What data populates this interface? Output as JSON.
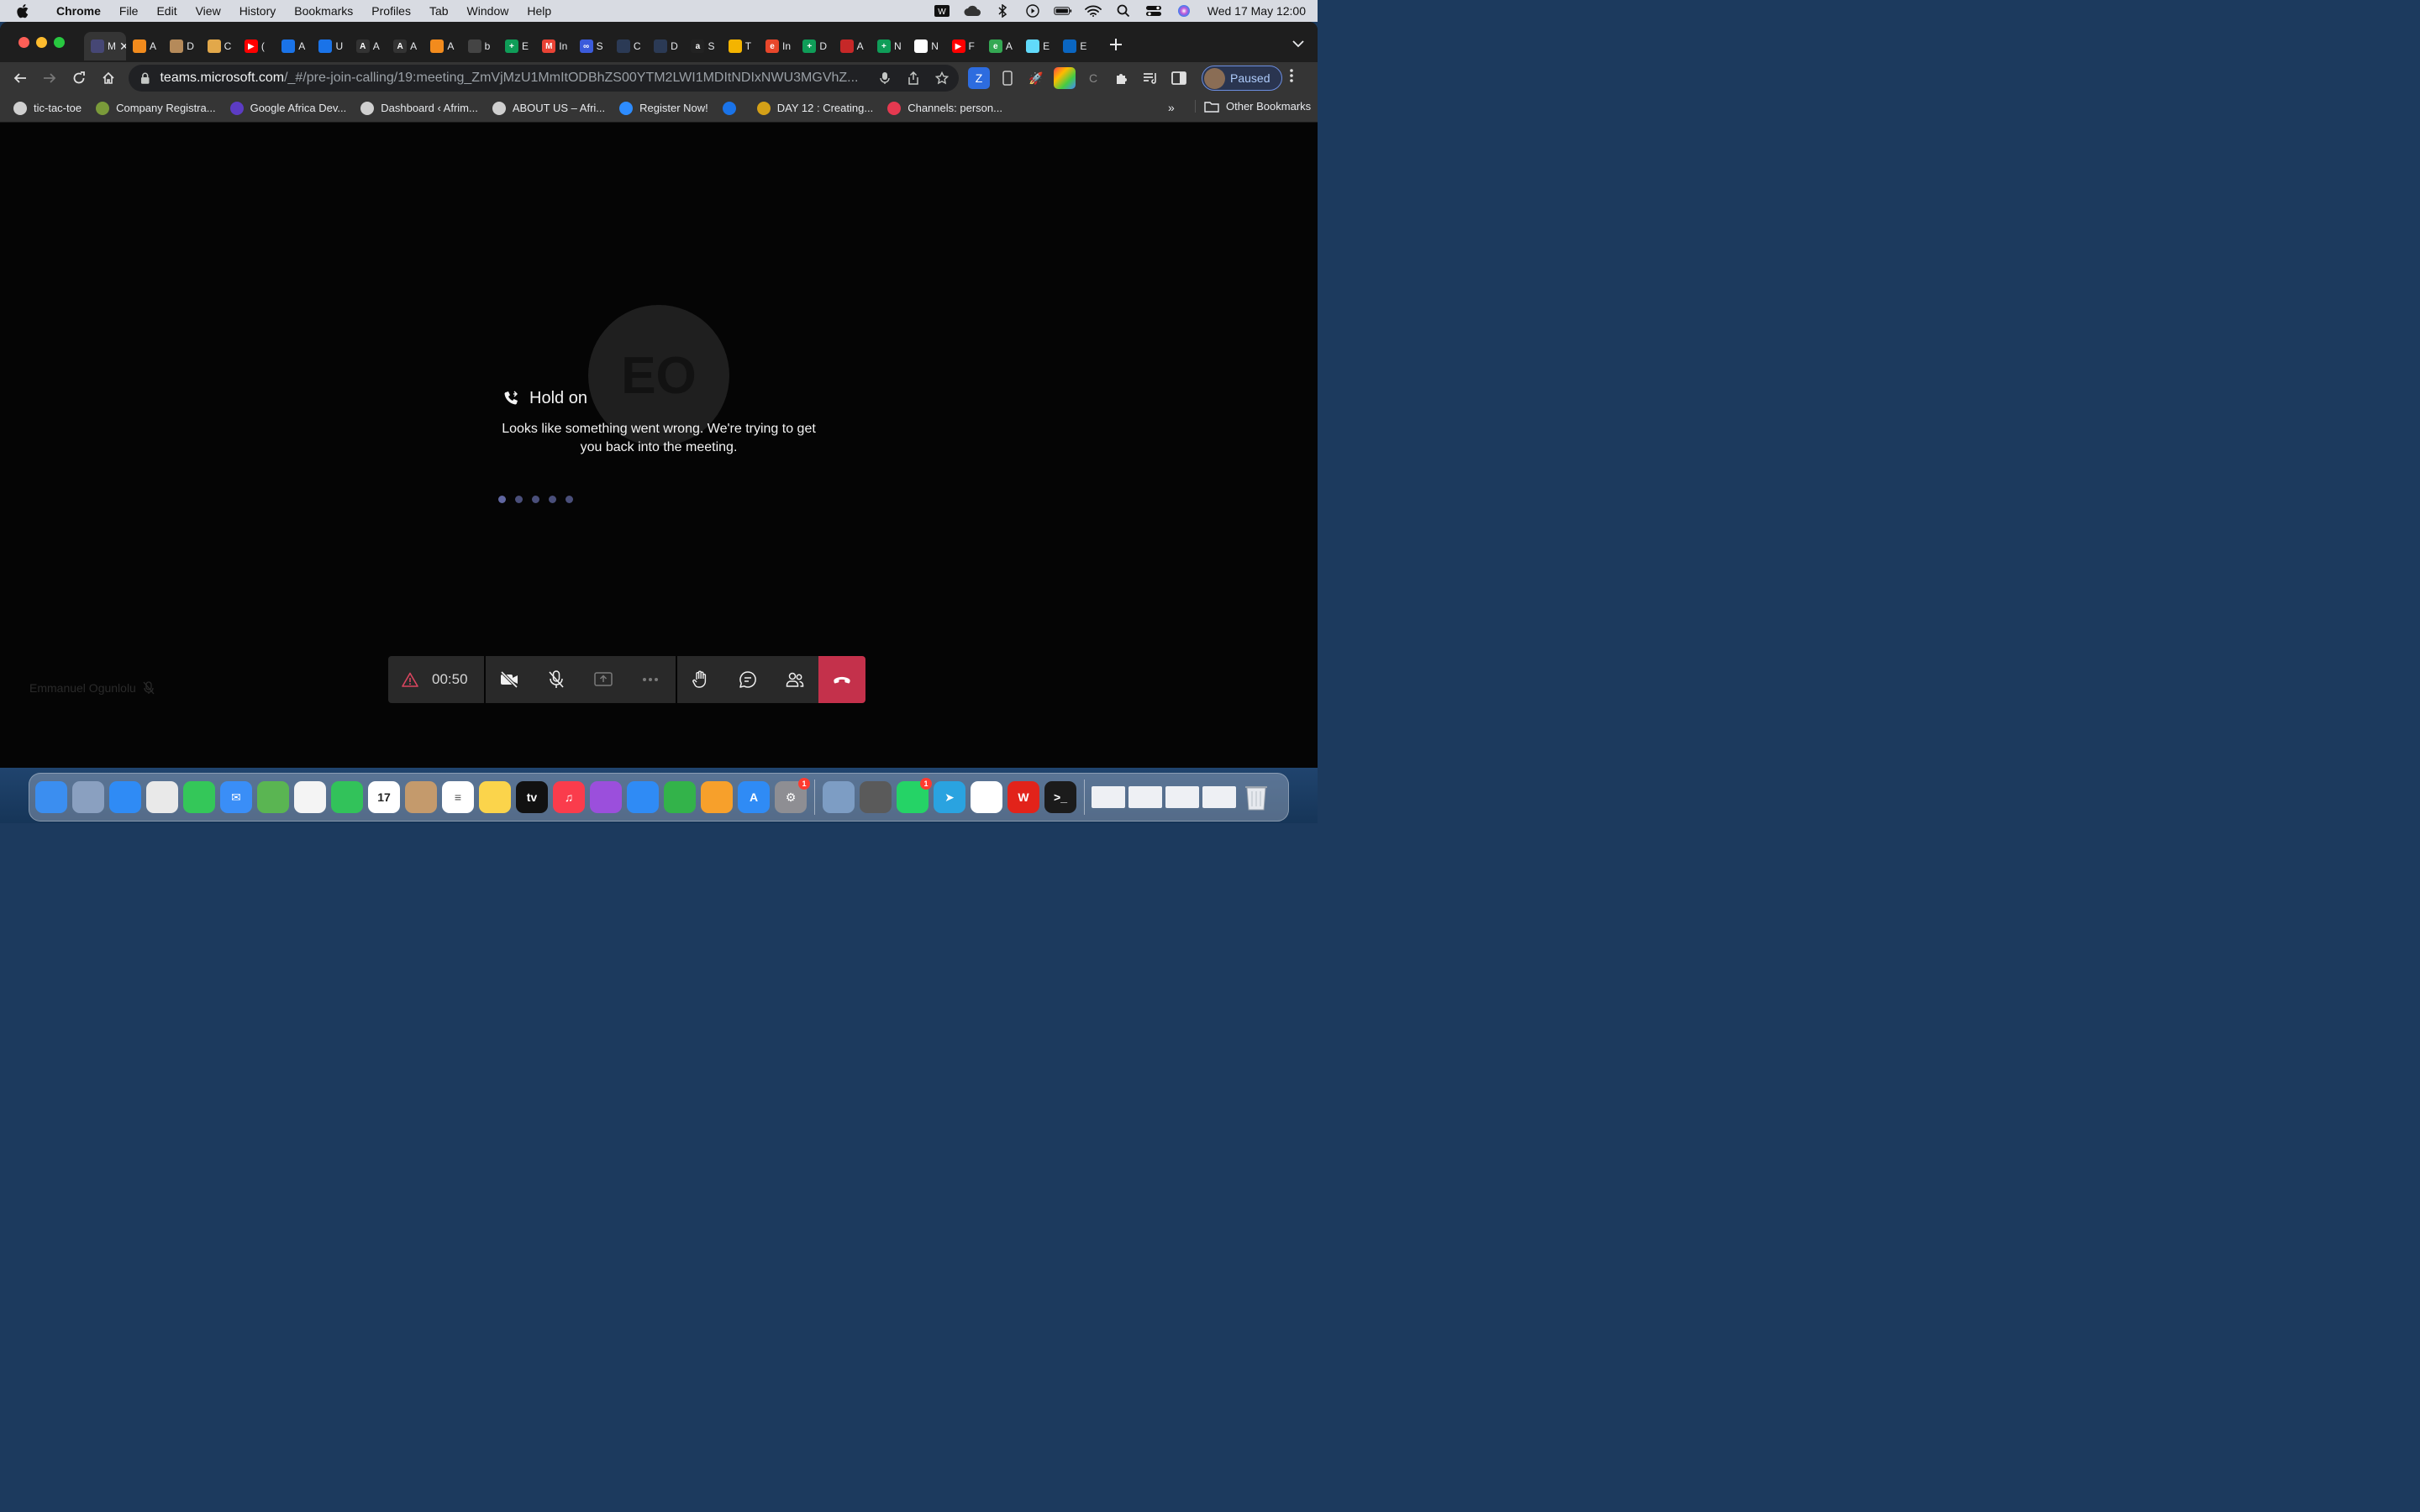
{
  "menubar": {
    "app_name": "Chrome",
    "items": [
      "File",
      "Edit",
      "View",
      "History",
      "Bookmarks",
      "Profiles",
      "Tab",
      "Window",
      "Help"
    ],
    "clock": "Wed 17 May  12:00"
  },
  "tabs": [
    {
      "label": "M",
      "color": "#464775",
      "glyph": "",
      "active": true
    },
    {
      "label": "A",
      "color": "#f28b1d",
      "glyph": ""
    },
    {
      "label": "D",
      "color": "#b58a5a",
      "glyph": ""
    },
    {
      "label": "C",
      "color": "#e2a84a",
      "glyph": ""
    },
    {
      "label": "(",
      "color": "#ff0000",
      "glyph": "▶"
    },
    {
      "label": "A",
      "color": "#1a73e8",
      "glyph": ""
    },
    {
      "label": "U",
      "color": "#1a73e8",
      "glyph": ""
    },
    {
      "label": "A",
      "color": "#333333",
      "glyph": "A"
    },
    {
      "label": "A",
      "color": "#333333",
      "glyph": "A"
    },
    {
      "label": "A",
      "color": "#f28b1d",
      "glyph": ""
    },
    {
      "label": "b",
      "color": "#444444",
      "glyph": ""
    },
    {
      "label": "E",
      "color": "#0f9d58",
      "glyph": "+"
    },
    {
      "label": "In",
      "color": "#ea4335",
      "glyph": "M"
    },
    {
      "label": "S",
      "color": "#3b5bdb",
      "glyph": "∞"
    },
    {
      "label": "C",
      "color": "#2b3a55",
      "glyph": ""
    },
    {
      "label": "D",
      "color": "#2b3a55",
      "glyph": ""
    },
    {
      "label": "S",
      "color": "#222222",
      "glyph": "a"
    },
    {
      "label": "T",
      "color": "#f4b400",
      "glyph": ""
    },
    {
      "label": "In",
      "color": "#e8472b",
      "glyph": "e"
    },
    {
      "label": "D",
      "color": "#0f9d58",
      "glyph": "+"
    },
    {
      "label": "A",
      "color": "#c62828",
      "glyph": ""
    },
    {
      "label": "N",
      "color": "#0f9d58",
      "glyph": "+"
    },
    {
      "label": "N",
      "color": "#ffffff",
      "glyph": ""
    },
    {
      "label": "F",
      "color": "#ff0000",
      "glyph": "▶"
    },
    {
      "label": "A",
      "color": "#34a853",
      "glyph": "e"
    },
    {
      "label": "E",
      "color": "#61dafb",
      "glyph": ""
    },
    {
      "label": "E",
      "color": "#0a66c2",
      "glyph": ""
    }
  ],
  "omnibox": {
    "host": "teams.microsoft.com",
    "path": "/_#/pre-join-calling/19:meeting_ZmVjMzU1MmItODBhZS00YTM2LWI1MDItNDIxNWU3MGVhZ..."
  },
  "profile": {
    "label": "Paused"
  },
  "bookmarks": [
    {
      "label": "tic-tac-toe",
      "color": "#cfcfcf"
    },
    {
      "label": "Company Registra...",
      "color": "#7a9a3a"
    },
    {
      "label": "Google Africa Dev...",
      "color": "#5c3cc4"
    },
    {
      "label": "Dashboard ‹ Afrim...",
      "color": "#cfcfcf"
    },
    {
      "label": "ABOUT US – Afri...",
      "color": "#cfcfcf"
    },
    {
      "label": "Register Now!",
      "color": "#2d8cff"
    },
    {
      "label": "",
      "color": "#1a73e8"
    },
    {
      "label": "DAY 12 : Creating...",
      "color": "#d4a017"
    },
    {
      "label": "Channels: person...",
      "color": "#e53950"
    }
  ],
  "bookmarks_more": "»",
  "other_bookmarks": "Other Bookmarks",
  "call": {
    "avatar_initials": "EO",
    "status_title": "Hold on",
    "status_message": "Looks like something went wrong. We're trying to get you back into the meeting.",
    "timer": "00:50",
    "participant_name": "Emmanuel Ogunlolu"
  },
  "dock": [
    {
      "name": "finder",
      "color": "#3b8ef0",
      "glyph": ""
    },
    {
      "name": "launchpad",
      "color": "#8aa0c0",
      "glyph": ""
    },
    {
      "name": "safari",
      "color": "#2f8bf5",
      "glyph": ""
    },
    {
      "name": "chrome",
      "color": "#e9e9e9",
      "glyph": ""
    },
    {
      "name": "messages",
      "color": "#34c759",
      "glyph": ""
    },
    {
      "name": "mail",
      "color": "#3a8ef7",
      "glyph": "✉"
    },
    {
      "name": "maps",
      "color": "#5ab552",
      "glyph": ""
    },
    {
      "name": "photos",
      "color": "#f4f4f4",
      "glyph": ""
    },
    {
      "name": "facetime",
      "color": "#32c25a",
      "glyph": ""
    },
    {
      "name": "calendar",
      "color": "#ffffff",
      "glyph": "17",
      "text_color": "#222222"
    },
    {
      "name": "contacts",
      "color": "#c49a6c",
      "glyph": ""
    },
    {
      "name": "reminders",
      "color": "#ffffff",
      "glyph": "≡",
      "text_color": "#555555"
    },
    {
      "name": "notes",
      "color": "#fbd44b",
      "glyph": ""
    },
    {
      "name": "apple-tv",
      "color": "#111111",
      "glyph": "tv"
    },
    {
      "name": "music",
      "color": "#fa3c4c",
      "glyph": "♫"
    },
    {
      "name": "podcasts",
      "color": "#9b4fdc",
      "glyph": ""
    },
    {
      "name": "keynote",
      "color": "#2f8bf5",
      "glyph": ""
    },
    {
      "name": "numbers",
      "color": "#33b34a",
      "glyph": ""
    },
    {
      "name": "pages",
      "color": "#f7a02b",
      "glyph": ""
    },
    {
      "name": "app-store",
      "color": "#2f8bf5",
      "glyph": "A"
    },
    {
      "name": "system-settings",
      "color": "#8e8e93",
      "glyph": "⚙",
      "badge": "1"
    },
    {
      "name": "preview",
      "color": "#7d9dc4",
      "glyph": ""
    },
    {
      "name": "keychain",
      "color": "#5a5a5a",
      "glyph": ""
    },
    {
      "name": "whatsapp",
      "color": "#25d366",
      "glyph": "",
      "badge": "1"
    },
    {
      "name": "telegram",
      "color": "#2aa3e0",
      "glyph": "➤"
    },
    {
      "name": "vscode",
      "color": "#ffffff",
      "glyph": "",
      "text_color": "#0a7acf"
    },
    {
      "name": "wps-office",
      "color": "#e2231a",
      "glyph": "W"
    },
    {
      "name": "terminal",
      "color": "#1b1b1b",
      "glyph": ">_"
    }
  ],
  "colors": {
    "hangup": "#c4314b",
    "content_bg": "#050505",
    "callbar_bg": "#292929"
  }
}
